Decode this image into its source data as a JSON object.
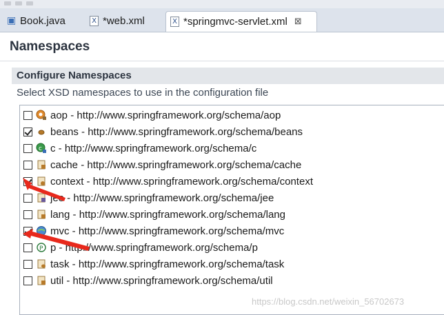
{
  "tabs": [
    {
      "label": "Book.java",
      "icon": "java-file-icon",
      "active": false
    },
    {
      "label": "*web.xml",
      "icon": "xml-file-icon",
      "active": false
    },
    {
      "label": "*springmvc-servlet.xml",
      "icon": "xml-file-icon",
      "active": true,
      "close": "⊠"
    }
  ],
  "page": {
    "title": "Namespaces",
    "group_title": "Configure Namespaces",
    "description": "Select XSD namespaces to use in the configuration file"
  },
  "namespaces": [
    {
      "label": "aop - http://www.springframework.org/schema/aop",
      "checked": false,
      "icon": "aop-icon"
    },
    {
      "label": "beans - http://www.springframework.org/schema/beans",
      "checked": true,
      "icon": "beans-icon"
    },
    {
      "label": "c - http://www.springframework.org/schema/c",
      "checked": false,
      "icon": "c-icon"
    },
    {
      "label": "cache - http://www.springframework.org/schema/cache",
      "checked": false,
      "icon": "cache-icon"
    },
    {
      "label": "context - http://www.springframework.org/schema/context",
      "checked": true,
      "icon": "context-icon"
    },
    {
      "label": "jee - http://www.springframework.org/schema/jee",
      "checked": false,
      "icon": "jee-icon"
    },
    {
      "label": "lang - http://www.springframework.org/schema/lang",
      "checked": false,
      "icon": "lang-icon"
    },
    {
      "label": "mvc - http://www.springframework.org/schema/mvc",
      "checked": true,
      "icon": "mvc-icon"
    },
    {
      "label": "p - http://www.springframework.org/schema/p",
      "checked": false,
      "icon": "p-icon"
    },
    {
      "label": "task - http://www.springframework.org/schema/task",
      "checked": false,
      "icon": "task-icon"
    },
    {
      "label": "util - http://www.springframework.org/schema/util",
      "checked": false,
      "icon": "util-icon"
    }
  ],
  "watermark": "https://blog.csdn.net/weixin_56702673",
  "colors": {
    "arrow": "#e8291c",
    "accent": "#2b4f8a"
  }
}
